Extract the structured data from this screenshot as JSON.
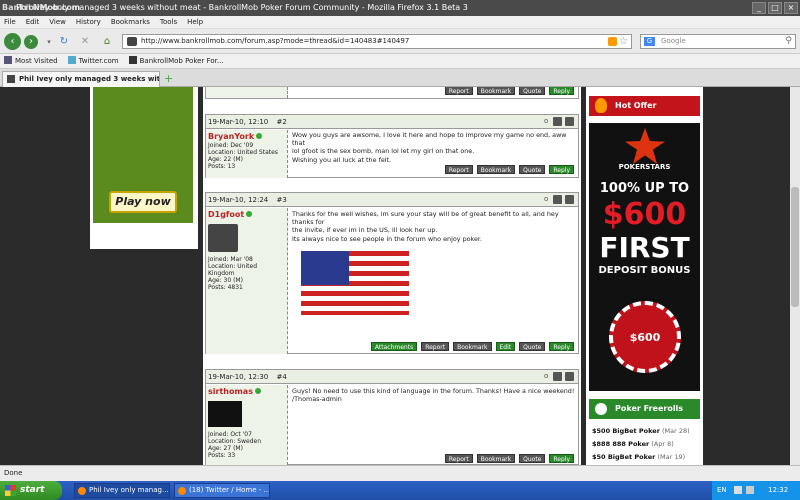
{
  "window": {
    "brand_mark": "BankrollMob.com",
    "title": "Phil Ivey only managed 3 weeks without meat - BankrollMob Poker Forum Community - Mozilla Firefox 3.1 Beta 3",
    "controls": [
      "_",
      "□",
      "×"
    ]
  },
  "menu": [
    "File",
    "Edit",
    "View",
    "History",
    "Bookmarks",
    "Tools",
    "Help"
  ],
  "nav": {
    "url": "http://www.bankrollmob.com/forum.asp?mode=thread&id=140483#140497",
    "search_placeholder": "Google",
    "search_engine_letter": "G"
  },
  "bookmarks": [
    "Most Visited",
    "Twitter.com",
    "BankrollMob Poker For..."
  ],
  "tab": {
    "label": "Phil Ivey only managed 3 weeks with...",
    "new_tab": "+"
  },
  "left_ad": {
    "cta": "Play now"
  },
  "top_post_actions": [
    "Report",
    "Bookmark",
    "Quote",
    "Reply"
  ],
  "posts": [
    {
      "date": "19-Mar-10, 12:10",
      "number": "#2",
      "author": "BryanYork",
      "joined": "Joined: Dec '09",
      "location": "Location: United States",
      "age": "Age: 22 (M)",
      "posts": "Posts: 13",
      "lines": [
        "Wow you guys are awsome, I love it here and hope to improve my game no end, aww that",
        "lol gfoot is the sex bomb, man lol let my girl on that one.",
        "Wishing you all luck at the felt."
      ],
      "actions": [
        "Report",
        "Bookmark",
        "Quote",
        "Reply"
      ]
    },
    {
      "date": "19-Mar-10, 12:24",
      "number": "#3",
      "author": "D1gfoot",
      "joined": "Joined: Mar '08",
      "location": "Location: United Kingdom",
      "age": "Age: 30 (M)",
      "posts": "Posts: 4831",
      "lines": [
        "Thanks for the well wishes, im sure your stay will be of great benefit to all, and hey thanks for",
        "the invite, if ever im in the US, ill look her up.",
        "Its always nice to see people in the forum who enjoy poker."
      ],
      "actions": [
        "Attachments",
        "Report",
        "Bookmark",
        "Edit",
        "Quote",
        "Reply"
      ]
    },
    {
      "date": "19-Mar-10, 12:30",
      "number": "#4",
      "author": "sirthomas",
      "joined": "Joined: Oct '07",
      "location": "Location: Sweden",
      "age": "Age: 27 (M)",
      "posts": "Posts: 33",
      "lines": [
        "Guys! No need to use this kind of language in the forum. Thanks! Have a nice weekend!",
        "/Thomas-admin"
      ],
      "actions": [
        "Report",
        "Bookmark",
        "Quote",
        "Reply"
      ]
    }
  ],
  "right_ad": {
    "hot_offer": "Hot Offer",
    "brand": "POKERSTARS",
    "line1": "100% UP TO",
    "line2": "$600",
    "line3": "FIRST",
    "line4": "DEPOSIT BONUS",
    "chip": "$600",
    "freerolls_title": "Poker Freerolls",
    "freerolls": [
      {
        "name": "$500 BigBet Poker",
        "date": "(Mar 28)"
      },
      {
        "name": "$888 888 Poker",
        "date": "(Apr 8)"
      },
      {
        "name": "$50 BigBet Poker",
        "date": "(Mar 19)"
      }
    ]
  },
  "status": "Done",
  "taskbar": {
    "start": "start",
    "tasks": [
      "Phil Ivey only manag...",
      "(18) Twitter / Home - ..."
    ],
    "lang": "EN",
    "clock": "12:32 PM"
  }
}
